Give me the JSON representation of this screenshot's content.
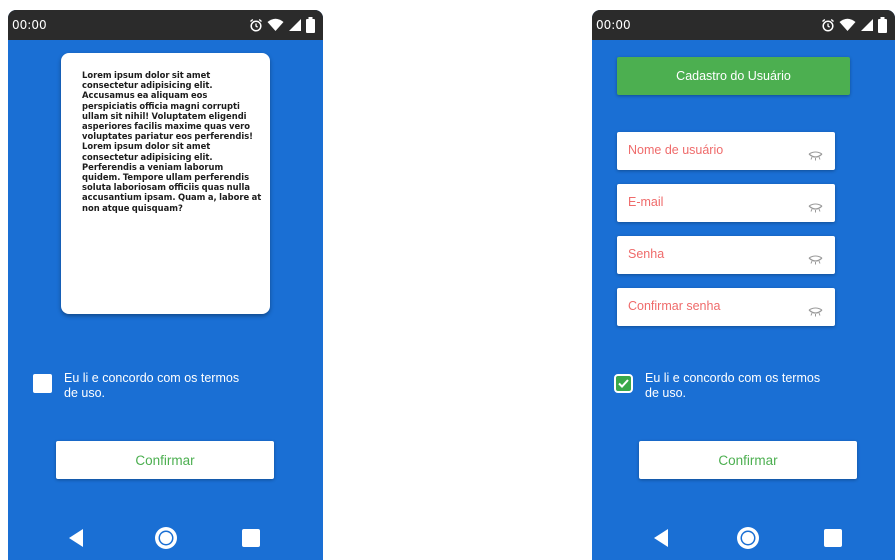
{
  "status_bar": {
    "time": "00:00",
    "icons": [
      "alarm-icon",
      "wifi-icon",
      "signal-icon",
      "battery-icon"
    ]
  },
  "terms_screen": {
    "terms_text": "Lorem ipsum dolor sit amet consectetur adipisicing elit. Accusamus ea aliquam eos perspiciatis officia magni corrupti ullam sit nihil! Voluptatem eligendi asperiores facilis maxime quas vero voluptates pariatur eos perferendis! Lorem ipsum dolor sit amet consectetur adipisicing elit. Perferendis a veniam laborum quidem. Tempore ullam perferendis soluta laboriosam officiis quas nulla accusantium ipsam. Quam a, labore at non atque quisquam?",
    "checkbox_label": "Eu li e concordo com os termos de uso.",
    "checkbox_checked": false,
    "confirm_label": "Confirmar"
  },
  "register_screen": {
    "header_label": "Cadastro do Usuário",
    "fields": [
      {
        "placeholder": "Nome de usuário"
      },
      {
        "placeholder": "E-mail"
      },
      {
        "placeholder": "Senha"
      },
      {
        "placeholder": "Confirmar senha"
      }
    ],
    "checkbox_label": "Eu li e concordo com os termos de uso.",
    "checkbox_checked": true,
    "confirm_label": "Confirmar"
  },
  "nav_bar": {
    "icons": [
      "back-icon",
      "home-icon",
      "recents-icon"
    ]
  },
  "colors": {
    "screen_bg": "#1a6fd4",
    "status_bar_bg": "#2b2b2b",
    "accent_green": "#4caf50",
    "placeholder_red": "#ef6b6b"
  }
}
